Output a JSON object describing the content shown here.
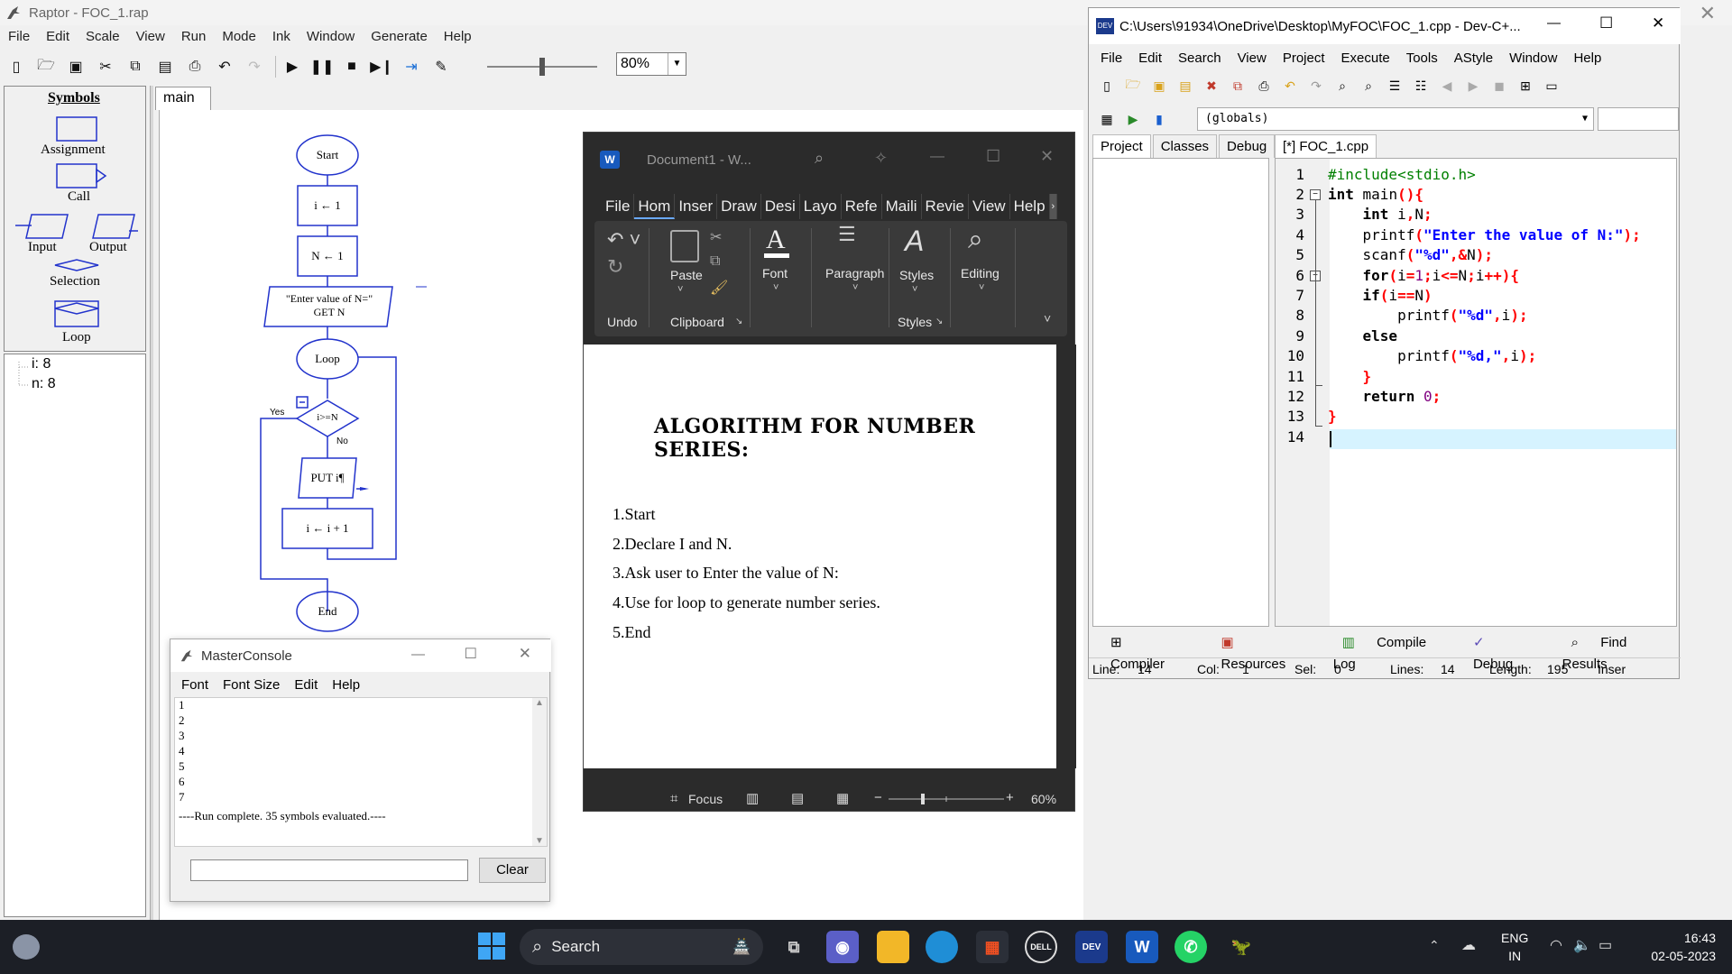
{
  "raptor": {
    "title": "Raptor - FOC_1.rap",
    "menu": [
      "File",
      "Edit",
      "Scale",
      "View",
      "Run",
      "Mode",
      "Ink",
      "Window",
      "Generate",
      "Help"
    ],
    "zoom": "80%",
    "symbols_title": "Symbols",
    "symbols": [
      "Assignment",
      "Call",
      "Input",
      "Output",
      "Selection",
      "Loop"
    ],
    "variables": [
      "i: 8",
      "n: 8"
    ],
    "tab": "main",
    "flowchart": {
      "start": "Start",
      "assign_i": "i ← 1",
      "assign_n": "N ← 1",
      "input_prompt": "\"Enter value of N=\"",
      "input_get": "GET N",
      "loop": "Loop",
      "condition": "i>=N",
      "yes": "Yes",
      "no": "No",
      "output": "PUT i¶",
      "increment": "i ← i + 1",
      "end": "End"
    }
  },
  "word": {
    "title": "Document1  -  W...",
    "menu": [
      "File",
      "Hom",
      "Inser",
      "Draw",
      "Desi",
      "Layo",
      "Refe",
      "Maili",
      "Revie",
      "View",
      "Help"
    ],
    "ribbon": {
      "undo": "Undo",
      "clipboard": "Clipboard",
      "paste": "Paste",
      "font": "Font",
      "paragraph": "Paragraph",
      "styles": "Styles",
      "styles_group": "Styles",
      "editing": "Editing"
    },
    "document": {
      "heading": "ALGORITHM FOR NUMBER SERIES:",
      "lines": [
        "1.Start",
        "2.Declare I and N.",
        "3.Ask user to Enter the value of N:",
        "4.Use for loop to generate number series.",
        "5.End"
      ]
    },
    "status": {
      "focus": "Focus",
      "zoom": "60%"
    }
  },
  "devcpp": {
    "title": "C:\\Users\\91934\\OneDrive\\Desktop\\MyFOC\\FOC_1.cpp - Dev-C+...",
    "menu": [
      "File",
      "Edit",
      "Search",
      "View",
      "Project",
      "Execute",
      "Tools",
      "AStyle",
      "Window",
      "Help"
    ],
    "globals": "(globals)",
    "left_tabs": [
      "Project",
      "Classes",
      "Debug"
    ],
    "file_tab": "[*] FOC_1.cpp",
    "line_numbers": [
      "1",
      "2",
      "3",
      "4",
      "5",
      "6",
      "7",
      "8",
      "9",
      "10",
      "11",
      "12",
      "13",
      "14"
    ],
    "bottom_tabs": [
      "Compiler",
      "Resources",
      "Compile Log",
      "Debug",
      "Find Results"
    ],
    "status": {
      "line_label": "Line:",
      "line": "14",
      "col_label": "Col:",
      "col": "1",
      "sel_label": "Sel:",
      "sel": "0",
      "lines_label": "Lines:",
      "lines": "14",
      "length_label": "Length:",
      "length": "195",
      "mode": "Inser"
    }
  },
  "console": {
    "title": "MasterConsole",
    "menu": [
      "Font",
      "Font Size",
      "Edit",
      "Help"
    ],
    "output": [
      "1",
      "2",
      "3",
      "4",
      "5",
      "6",
      "7",
      "----Run complete.  35 symbols evaluated.----"
    ],
    "clear": "Clear"
  },
  "taskbar": {
    "search": "Search",
    "lang1": "ENG",
    "lang2": "IN",
    "time": "16:43",
    "date": "02-05-2023"
  }
}
